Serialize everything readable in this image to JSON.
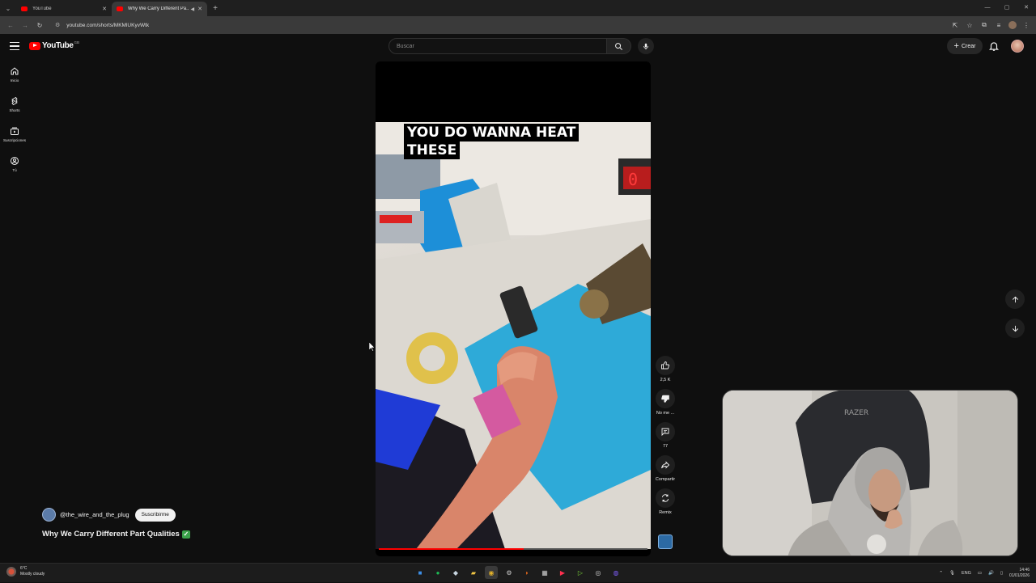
{
  "browser": {
    "tabs": [
      {
        "title": "YouTube",
        "active": false
      },
      {
        "title": "Why We Carry Different Pa...",
        "active": true
      }
    ],
    "url": "youtube.com/shorts/MKMlUKyvWtk"
  },
  "header": {
    "logo_text": "YouTube",
    "country": "GB",
    "search_placeholder": "Buscar",
    "create_label": "Crear"
  },
  "sidebar": {
    "items": [
      {
        "label": "Inicio",
        "icon": "home-icon"
      },
      {
        "label": "Shorts",
        "icon": "shorts-icon"
      },
      {
        "label": "Suscripciones",
        "icon": "subscriptions-icon"
      },
      {
        "label": "Tú",
        "icon": "you-icon"
      }
    ]
  },
  "short": {
    "caption_line1": "YOU DO WANNA HEAT",
    "caption_line2": "THESE",
    "progress": 0.54,
    "channel_name": "@the_wire_and_the_plug",
    "subscribe_label": "Suscribirme",
    "title": "Why We Carry Different Part Qualities",
    "title_badge": "✓"
  },
  "actions": {
    "like_count": "2,5 K",
    "dislike_label": "No me ...",
    "comments_count": "77",
    "share_label": "Compartir",
    "remix_label": "Remix"
  },
  "taskbar": {
    "weather_temp": "6°C",
    "weather_text": "Mostly cloudy",
    "lang": "ENG",
    "time": "14:46",
    "date": "01/01/2026"
  },
  "colors": {
    "accent": "#ff0000",
    "background": "#0f0f0f",
    "check": "#3aa14a"
  }
}
